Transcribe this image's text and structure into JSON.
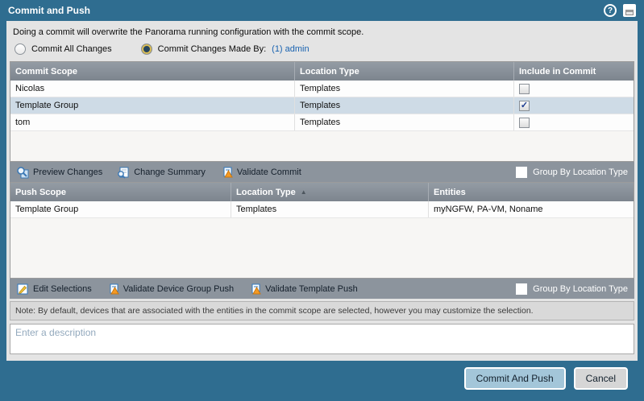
{
  "dialog": {
    "title": "Commit and Push",
    "description": "Doing a commit will overwrite the Panorama running configuration with the commit scope.",
    "radios": {
      "all": {
        "label": "Commit All Changes",
        "selected": false
      },
      "by": {
        "label": "Commit Changes Made By:",
        "link": "(1) admin",
        "selected": true
      }
    }
  },
  "commit_table": {
    "columns": {
      "scope": "Commit Scope",
      "location": "Location Type",
      "include": "Include in Commit"
    },
    "rows": [
      {
        "scope": "Nicolas",
        "location": "Templates",
        "include": false,
        "selected": false
      },
      {
        "scope": "Template Group",
        "location": "Templates",
        "include": true,
        "selected": true
      },
      {
        "scope": "tom",
        "location": "Templates",
        "include": false,
        "selected": false
      }
    ]
  },
  "commit_toolbar": {
    "preview_changes": "Preview Changes",
    "change_summary": "Change Summary",
    "validate_commit": "Validate Commit",
    "group_by_label": "Group By Location Type",
    "group_by_checked": false
  },
  "push_table": {
    "columns": {
      "scope": "Push Scope",
      "location": "Location Type",
      "entities": "Entities"
    },
    "sort_arrow": "▲",
    "rows": [
      {
        "scope": "Template Group",
        "location": "Templates",
        "entities": "myNGFW, PA-VM, Noname"
      }
    ]
  },
  "push_toolbar": {
    "edit_selections": "Edit Selections",
    "validate_device_group_push": "Validate Device Group Push",
    "validate_template_push": "Validate Template Push",
    "group_by_label": "Group By Location Type",
    "group_by_checked": false
  },
  "note": "Note: By default, devices that are associated with the entities in the commit scope are selected, however you may customize the selection.",
  "description_input": {
    "placeholder": "Enter a description",
    "value": ""
  },
  "footer": {
    "commit_and_push": "Commit And Push",
    "cancel": "Cancel"
  },
  "colors": {
    "chrome_blue": "#2f6d90",
    "content_gray": "#e4e4e4",
    "header_gray": "#848c95",
    "selected_row": "#cedbe6",
    "toolbar_gray": "#8c949d",
    "link_blue": "#1862b0",
    "primary_button": "#a3c6d9",
    "check_blue": "#1b3a8f",
    "validate_orange": "#f59a23"
  }
}
